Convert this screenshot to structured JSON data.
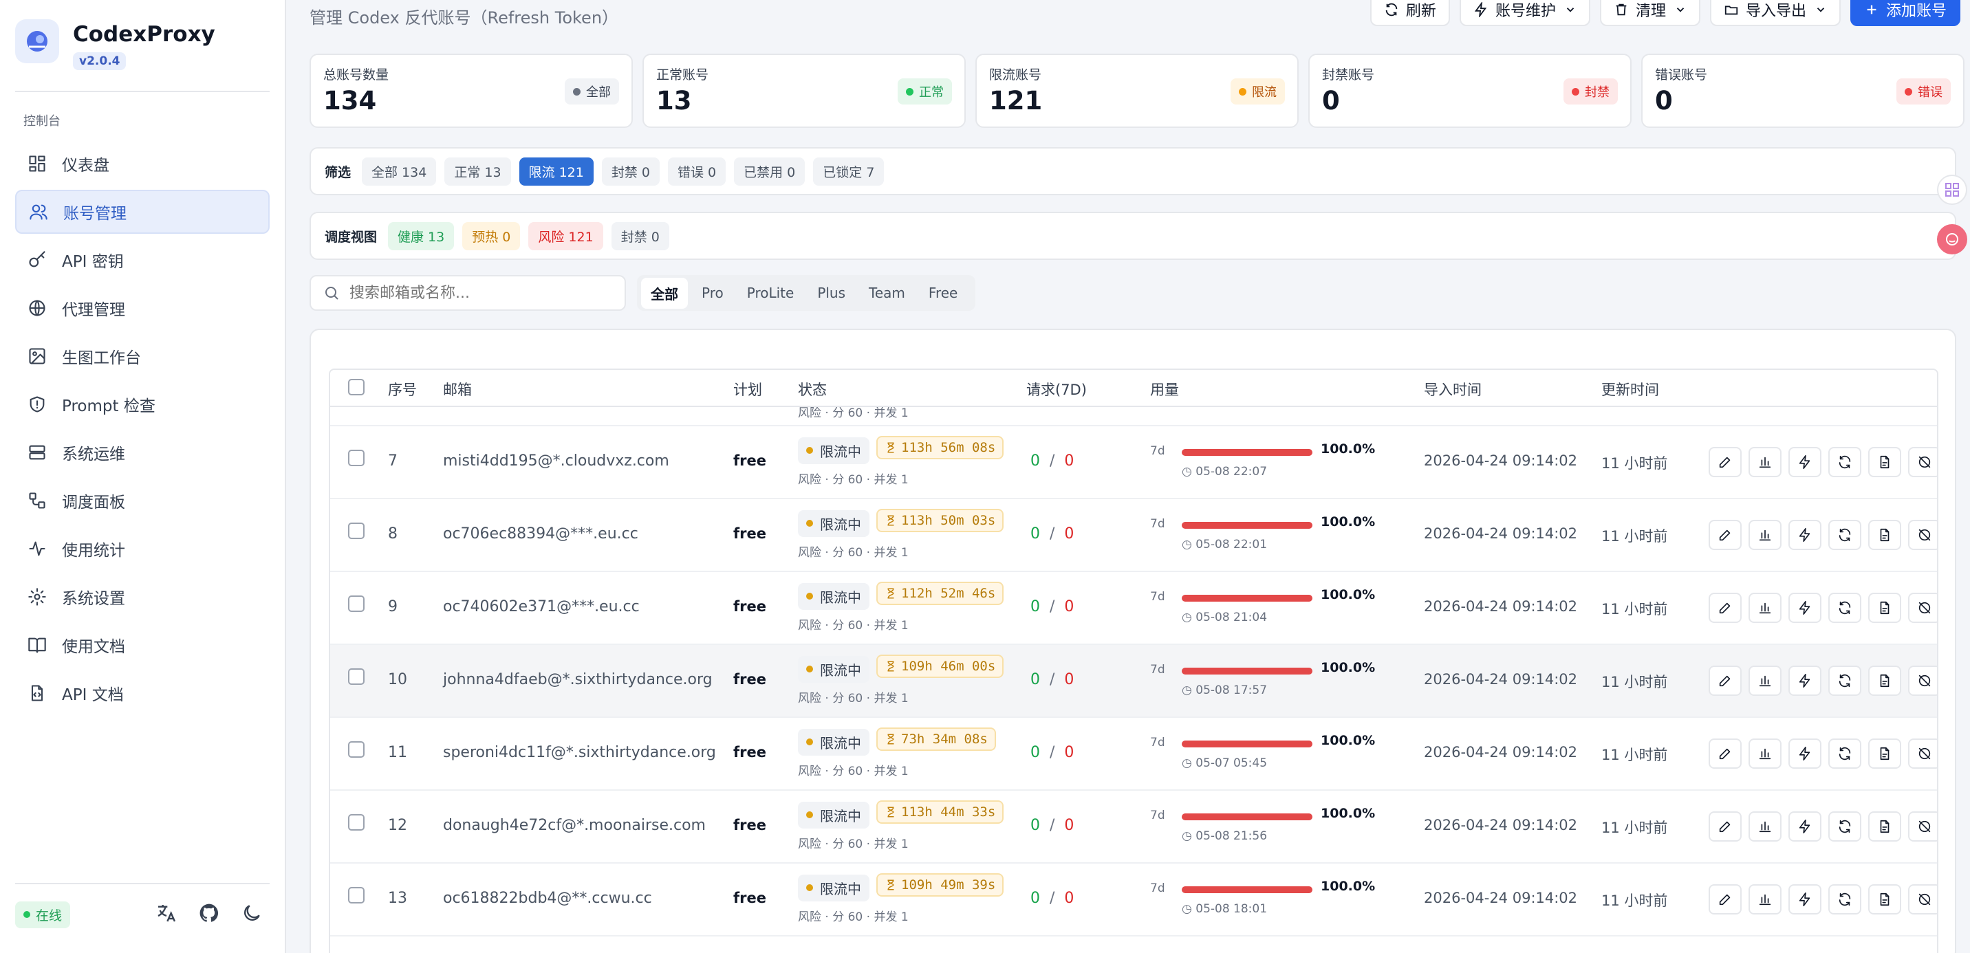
{
  "sidebar": {
    "app_name": "CodexProxy",
    "version": "v2.0.4",
    "section": "控制台",
    "items": [
      {
        "label": "仪表盘",
        "icon": "dashboard-icon"
      },
      {
        "label": "账号管理",
        "icon": "users-icon",
        "active": true
      },
      {
        "label": "API 密钥",
        "icon": "key-icon"
      },
      {
        "label": "代理管理",
        "icon": "globe-icon"
      },
      {
        "label": "生图工作台",
        "icon": "image-icon"
      },
      {
        "label": "Prompt 检查",
        "icon": "shield-icon"
      },
      {
        "label": "系统运维",
        "icon": "server-icon"
      },
      {
        "label": "调度面板",
        "icon": "workflow-icon"
      },
      {
        "label": "使用统计",
        "icon": "activity-icon"
      },
      {
        "label": "系统设置",
        "icon": "gear-icon"
      },
      {
        "label": "使用文档",
        "icon": "book-icon"
      },
      {
        "label": "API 文档",
        "icon": "file-code-icon"
      }
    ],
    "status": "在线"
  },
  "header": {
    "subtitle": "管理 Codex 反代账号（Refresh Token）",
    "buttons": {
      "refresh": "刷新",
      "maintain": "账号维护",
      "clean": "清理",
      "import_export": "导入导出",
      "add": "添加账号"
    }
  },
  "stats": [
    {
      "label": "总账号数量",
      "value": "134",
      "badge": "全部",
      "color": "#6b7280",
      "bg": "#f1f3f6",
      "fg": "#374151"
    },
    {
      "label": "正常账号",
      "value": "13",
      "badge": "正常",
      "color": "#22c55e",
      "bg": "#e6f7ec",
      "fg": "#1f9d55"
    },
    {
      "label": "限流账号",
      "value": "121",
      "badge": "限流",
      "color": "#f59e0b",
      "bg": "#fff4e0",
      "fg": "#b45309"
    },
    {
      "label": "封禁账号",
      "value": "0",
      "badge": "封禁",
      "color": "#ef4444",
      "bg": "#fde8e8",
      "fg": "#dc2626"
    },
    {
      "label": "错误账号",
      "value": "0",
      "badge": "错误",
      "color": "#ef4444",
      "bg": "#fde8e8",
      "fg": "#dc2626"
    }
  ],
  "filter": {
    "title": "筛选",
    "chips": [
      "全部 134",
      "正常 13",
      "限流 121",
      "封禁 0",
      "错误 0",
      "已禁用 0",
      "已锁定 7"
    ],
    "active": 2
  },
  "schedule": {
    "title": "调度视图",
    "chips": [
      {
        "label": "健康 13",
        "bg": "#e6f7ec",
        "fg": "#1f9d55"
      },
      {
        "label": "预热 0",
        "bg": "#fff4e0",
        "fg": "#c27a06"
      },
      {
        "label": "风险 121",
        "bg": "#fde8e8",
        "fg": "#dc2626"
      },
      {
        "label": "封禁 0",
        "bg": "#f1f3f6",
        "fg": "#4b5563"
      }
    ]
  },
  "search": {
    "placeholder": "搜索邮箱或名称..."
  },
  "plans": [
    "全部",
    "Pro",
    "ProLite",
    "Plus",
    "Team",
    "Free"
  ],
  "table": {
    "columns": [
      "序号",
      "邮箱",
      "计划",
      "状态",
      "请求(7D)",
      "用量",
      "导入时间",
      "更新时间"
    ],
    "partial_row_text": "风险 · 分 60 · 并发 1",
    "rows": [
      {
        "id": "7",
        "email": "misti4dd195@*.cloudvxz.com",
        "plan": "free",
        "status": "限流中",
        "timer": "113h 56m 08s",
        "risk": "风险 · 分 60 · 并发 1",
        "ok": "0",
        "fail": "0",
        "window": "7d",
        "usage": 100,
        "usage_text": "100.0%",
        "reset": "05-08 22:07",
        "imported": "2026-04-24 09:14:02",
        "updated": "11 小时前"
      },
      {
        "id": "8",
        "email": "oc706ec88394@***.eu.cc",
        "plan": "free",
        "status": "限流中",
        "timer": "113h 50m 03s",
        "risk": "风险 · 分 60 · 并发 1",
        "ok": "0",
        "fail": "0",
        "window": "7d",
        "usage": 100,
        "usage_text": "100.0%",
        "reset": "05-08 22:01",
        "imported": "2026-04-24 09:14:02",
        "updated": "11 小时前"
      },
      {
        "id": "9",
        "email": "oc740602e371@***.eu.cc",
        "plan": "free",
        "status": "限流中",
        "timer": "112h 52m 46s",
        "risk": "风险 · 分 60 · 并发 1",
        "ok": "0",
        "fail": "0",
        "window": "7d",
        "usage": 100,
        "usage_text": "100.0%",
        "reset": "05-08 21:04",
        "imported": "2026-04-24 09:14:02",
        "updated": "11 小时前"
      },
      {
        "id": "10",
        "email": "johnna4dfaeb@*.sixthirtydance.org",
        "plan": "free",
        "status": "限流中",
        "timer": "109h 46m 00s",
        "risk": "风险 · 分 60 · 并发 1",
        "ok": "0",
        "fail": "0",
        "window": "7d",
        "usage": 100,
        "usage_text": "100.0%",
        "reset": "05-08 17:57",
        "imported": "2026-04-24 09:14:02",
        "updated": "11 小时前",
        "highlight": true
      },
      {
        "id": "11",
        "email": "speroni4dc11f@*.sixthirtydance.org",
        "plan": "free",
        "status": "限流中",
        "timer": "73h 34m 08s",
        "risk": "风险 · 分 60 · 并发 1",
        "ok": "0",
        "fail": "0",
        "window": "7d",
        "usage": 100,
        "usage_text": "100.0%",
        "reset": "05-07 05:45",
        "imported": "2026-04-24 09:14:02",
        "updated": "11 小时前"
      },
      {
        "id": "12",
        "email": "donaugh4e72cf@*.moonairse.com",
        "plan": "free",
        "status": "限流中",
        "timer": "113h 44m 33s",
        "risk": "风险 · 分 60 · 并发 1",
        "ok": "0",
        "fail": "0",
        "window": "7d",
        "usage": 100,
        "usage_text": "100.0%",
        "reset": "05-08 21:56",
        "imported": "2026-04-24 09:14:02",
        "updated": "11 小时前"
      },
      {
        "id": "13",
        "email": "oc618822bdb4@**.ccwu.cc",
        "plan": "free",
        "status": "限流中",
        "timer": "109h 49m 39s",
        "risk": "风险 · 分 60 · 并发 1",
        "ok": "0",
        "fail": "0",
        "window": "7d",
        "usage": 100,
        "usage_text": "100.0%",
        "reset": "05-08 18:01",
        "imported": "2026-04-24 09:14:02",
        "updated": "11 小时前"
      }
    ],
    "row_actions": [
      "edit-icon",
      "chart-icon",
      "zap-icon",
      "refresh-icon",
      "file-icon",
      "pause-icon",
      "lock-icon"
    ]
  }
}
